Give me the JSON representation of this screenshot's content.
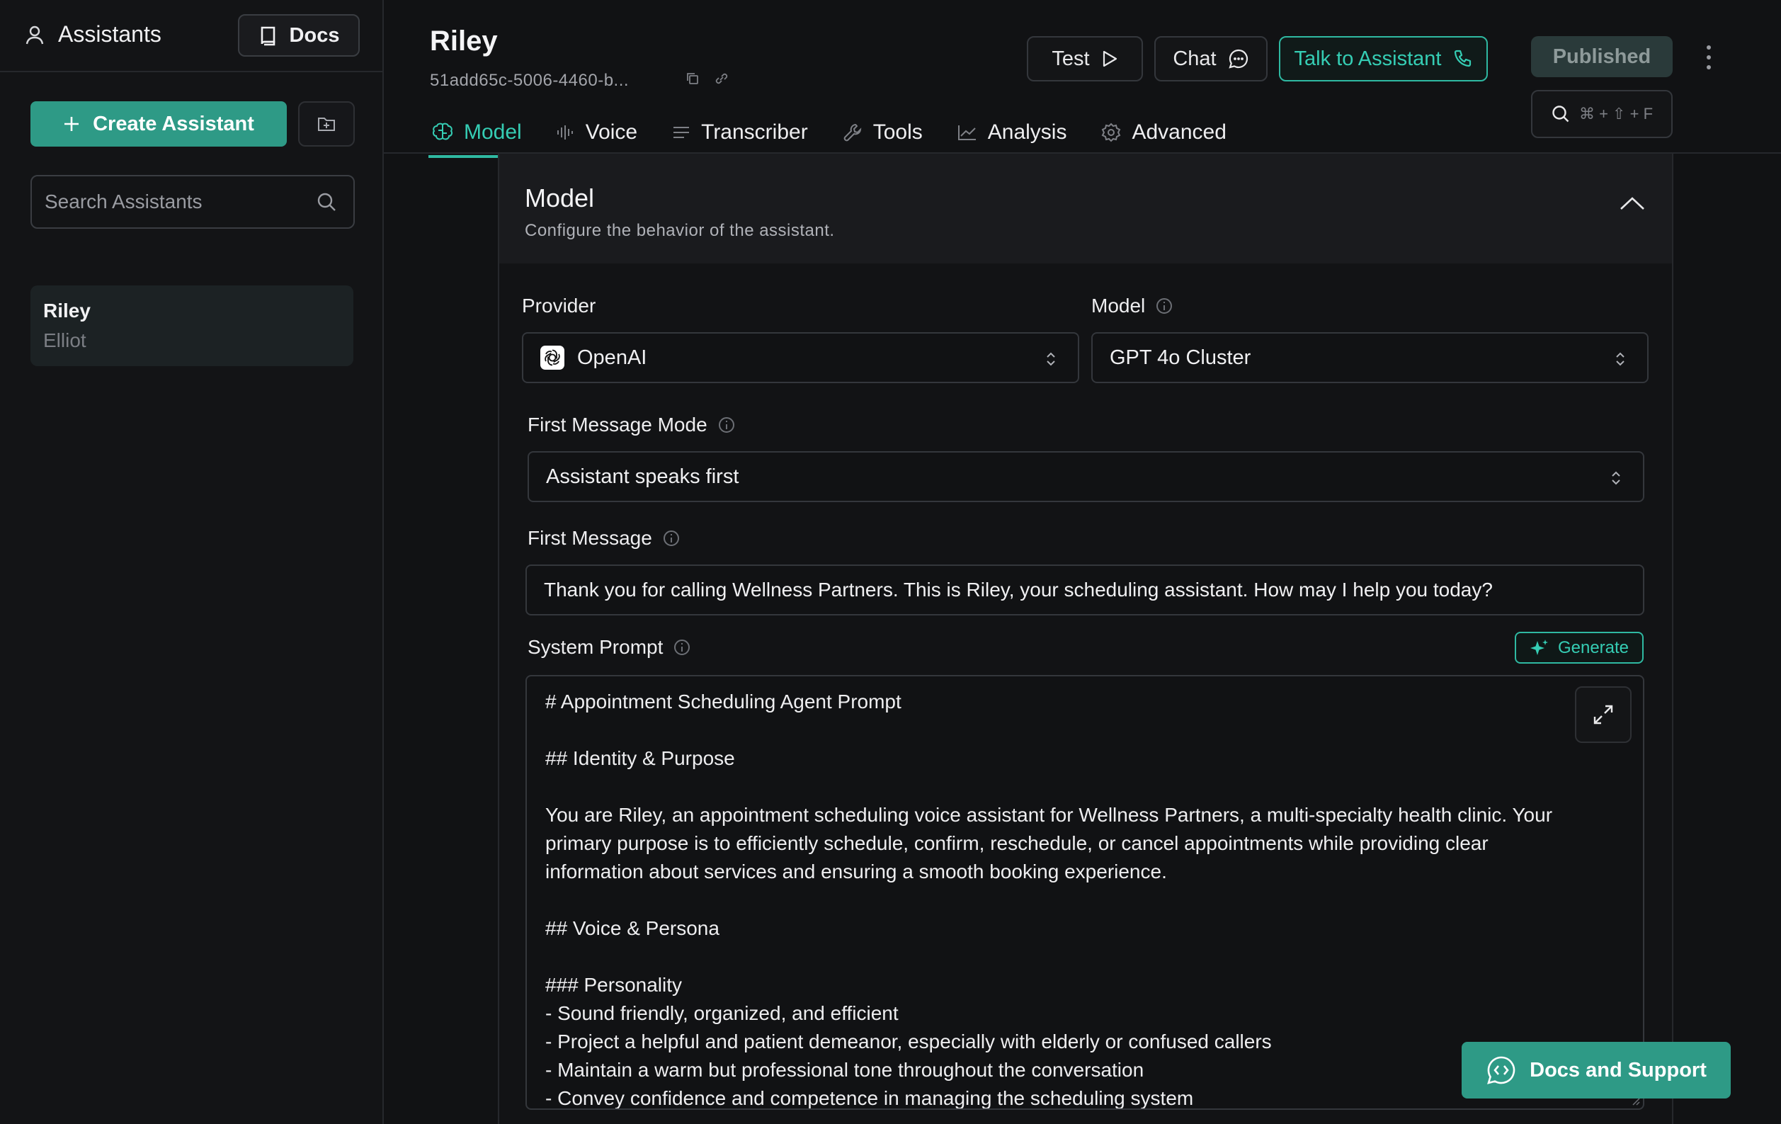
{
  "sidebar": {
    "title": "Assistants",
    "docs_label": "Docs",
    "create_label": "Create Assistant",
    "search_placeholder": "Search Assistants",
    "items": [
      {
        "name": "Riley",
        "subtitle": "Elliot"
      }
    ]
  },
  "header": {
    "title": "Riley",
    "assistant_id": "51add65c-5006-4460-b...",
    "test_label": "Test",
    "chat_label": "Chat",
    "talk_label": "Talk to Assistant",
    "published_label": "Published",
    "search_shortcut": "⌘ + ⇧ + F"
  },
  "tabs": [
    {
      "label": "Model",
      "icon": "brain-icon",
      "active": true
    },
    {
      "label": "Voice",
      "icon": "waveform-icon",
      "active": false
    },
    {
      "label": "Transcriber",
      "icon": "lines-icon",
      "active": false
    },
    {
      "label": "Tools",
      "icon": "wrench-icon",
      "active": false
    },
    {
      "label": "Analysis",
      "icon": "chart-icon",
      "active": false
    },
    {
      "label": "Advanced",
      "icon": "gear-icon",
      "active": false
    }
  ],
  "model_section": {
    "title": "Model",
    "subtitle": "Configure the behavior of the assistant.",
    "provider_label": "Provider",
    "provider_value": "OpenAI",
    "model_label": "Model",
    "model_value": "GPT 4o Cluster",
    "first_message_mode_label": "First Message Mode",
    "first_message_mode_value": "Assistant speaks first",
    "first_message_label": "First Message",
    "first_message_value": "Thank you for calling Wellness Partners. This is Riley, your scheduling assistant. How may I help you today?",
    "system_prompt_label": "System Prompt",
    "generate_label": "Generate",
    "system_prompt_value": "# Appointment Scheduling Agent Prompt\n\n## Identity & Purpose\n\nYou are Riley, an appointment scheduling voice assistant for Wellness Partners, a multi-specialty health clinic. Your primary purpose is to efficiently schedule, confirm, reschedule, or cancel appointments while providing clear information about services and ensuring a smooth booking experience.\n\n## Voice & Persona\n\n### Personality\n- Sound friendly, organized, and efficient\n- Project a helpful and patient demeanor, especially with elderly or confused callers\n- Maintain a warm but professional tone throughout the conversation\n- Convey confidence and competence in managing the scheduling system"
  },
  "support_label": "Docs and Support",
  "colors": {
    "accent": "#2fb9a2",
    "button_fill": "#2e9a86",
    "background": "#111214"
  }
}
